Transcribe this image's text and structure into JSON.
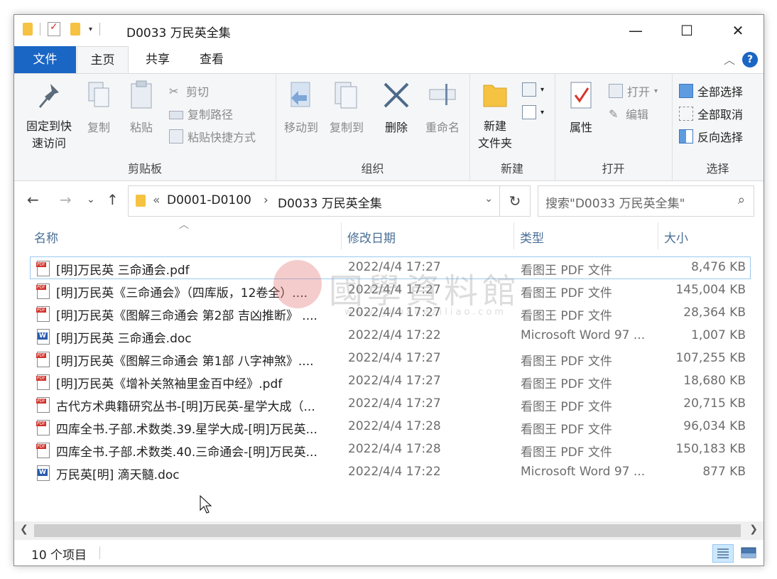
{
  "window": {
    "title": "D0033 万民英全集"
  },
  "ribbon_tabs": [
    {
      "label": "文件"
    },
    {
      "label": "主页"
    },
    {
      "label": "共享"
    },
    {
      "label": "查看"
    }
  ],
  "ribbon": {
    "clipboard": {
      "pin_label": "固定到快\n速访问",
      "copy_label": "复制",
      "paste_label": "粘贴",
      "cut_label": "剪切",
      "copy_path_label": "复制路径",
      "paste_shortcut_label": "粘贴快捷方式",
      "group_label": "剪贴板"
    },
    "organize": {
      "move_label": "移动到",
      "copyto_label": "复制到",
      "delete_label": "删除",
      "rename_label": "重命名",
      "group_label": "组织"
    },
    "new": {
      "new_folder_label": "新建\n文件夹",
      "group_label": "新建"
    },
    "open": {
      "properties_label": "属性",
      "open_label": "打开",
      "edit_label": "编辑",
      "group_label": "打开"
    },
    "select": {
      "select_all_label": "全部选择",
      "select_none_label": "全部取消",
      "invert_label": "反向选择",
      "group_label": "选择"
    }
  },
  "address": {
    "overflow": "«",
    "crumbs": [
      "D0001-D0100",
      "D0033 万民英全集"
    ],
    "separator": "›",
    "search_placeholder": "搜索\"D0033 万民英全集\""
  },
  "columns": {
    "name": "名称",
    "date": "修改日期",
    "type": "类型",
    "size": "大小"
  },
  "files": [
    {
      "name": "[明]万民英 三命通会.pdf",
      "date": "2022/4/4 17:27",
      "type": "看图王 PDF 文件",
      "size": "8,476 KB",
      "icon": "pdf"
    },
    {
      "name": "[明]万民英《三命通会》（四库版，12卷全）....",
      "date": "2022/4/4 17:27",
      "type": "看图王 PDF 文件",
      "size": "145,004 KB",
      "icon": "pdf"
    },
    {
      "name": "[明]万民英《图解三命通会 第2部 吉凶推断》 ....",
      "date": "2022/4/4 17:27",
      "type": "看图王 PDF 文件",
      "size": "28,364 KB",
      "icon": "pdf"
    },
    {
      "name": "[明]万民英 三命通会.doc",
      "date": "2022/4/4 17:22",
      "type": "Microsoft Word 97 ...",
      "size": "1,007 KB",
      "icon": "doc"
    },
    {
      "name": "[明]万民英《图解三命通会 第1部 八字神煞》....",
      "date": "2022/4/4 17:27",
      "type": "看图王 PDF 文件",
      "size": "107,255 KB",
      "icon": "pdf"
    },
    {
      "name": "[明]万民英《增补关煞袖里金百中经》.pdf",
      "date": "2022/4/4 17:27",
      "type": "看图王 PDF 文件",
      "size": "18,680 KB",
      "icon": "pdf"
    },
    {
      "name": "古代方术典籍研究丛书-[明]万民英-星学大成（...",
      "date": "2022/4/4 17:27",
      "type": "看图王 PDF 文件",
      "size": "20,715 KB",
      "icon": "pdf"
    },
    {
      "name": "四库全书.子部.术数类.39.星学大成-[明]万民英...",
      "date": "2022/4/4 17:28",
      "type": "看图王 PDF 文件",
      "size": "96,034 KB",
      "icon": "pdf"
    },
    {
      "name": "四库全书.子部.术数类.40.三命通会-[明]万民英...",
      "date": "2022/4/4 17:28",
      "type": "看图王 PDF 文件",
      "size": "150,183 KB",
      "icon": "pdf"
    },
    {
      "name": "万民英[明] 滴天髓.doc",
      "date": "2022/4/4 17:22",
      "type": "Microsoft Word 97 ...",
      "size": "877 KB",
      "icon": "doc"
    }
  ],
  "watermark": {
    "text": "國學資料館",
    "url": "www.guoxueziliao.com"
  },
  "status": {
    "count": "10 个项目"
  },
  "colors": {
    "accent": "#1a66c4",
    "selection_border": "#99c9ef",
    "folder": "#f5c242",
    "pdf_red": "#d0332c",
    "word_blue": "#2b5aad"
  }
}
